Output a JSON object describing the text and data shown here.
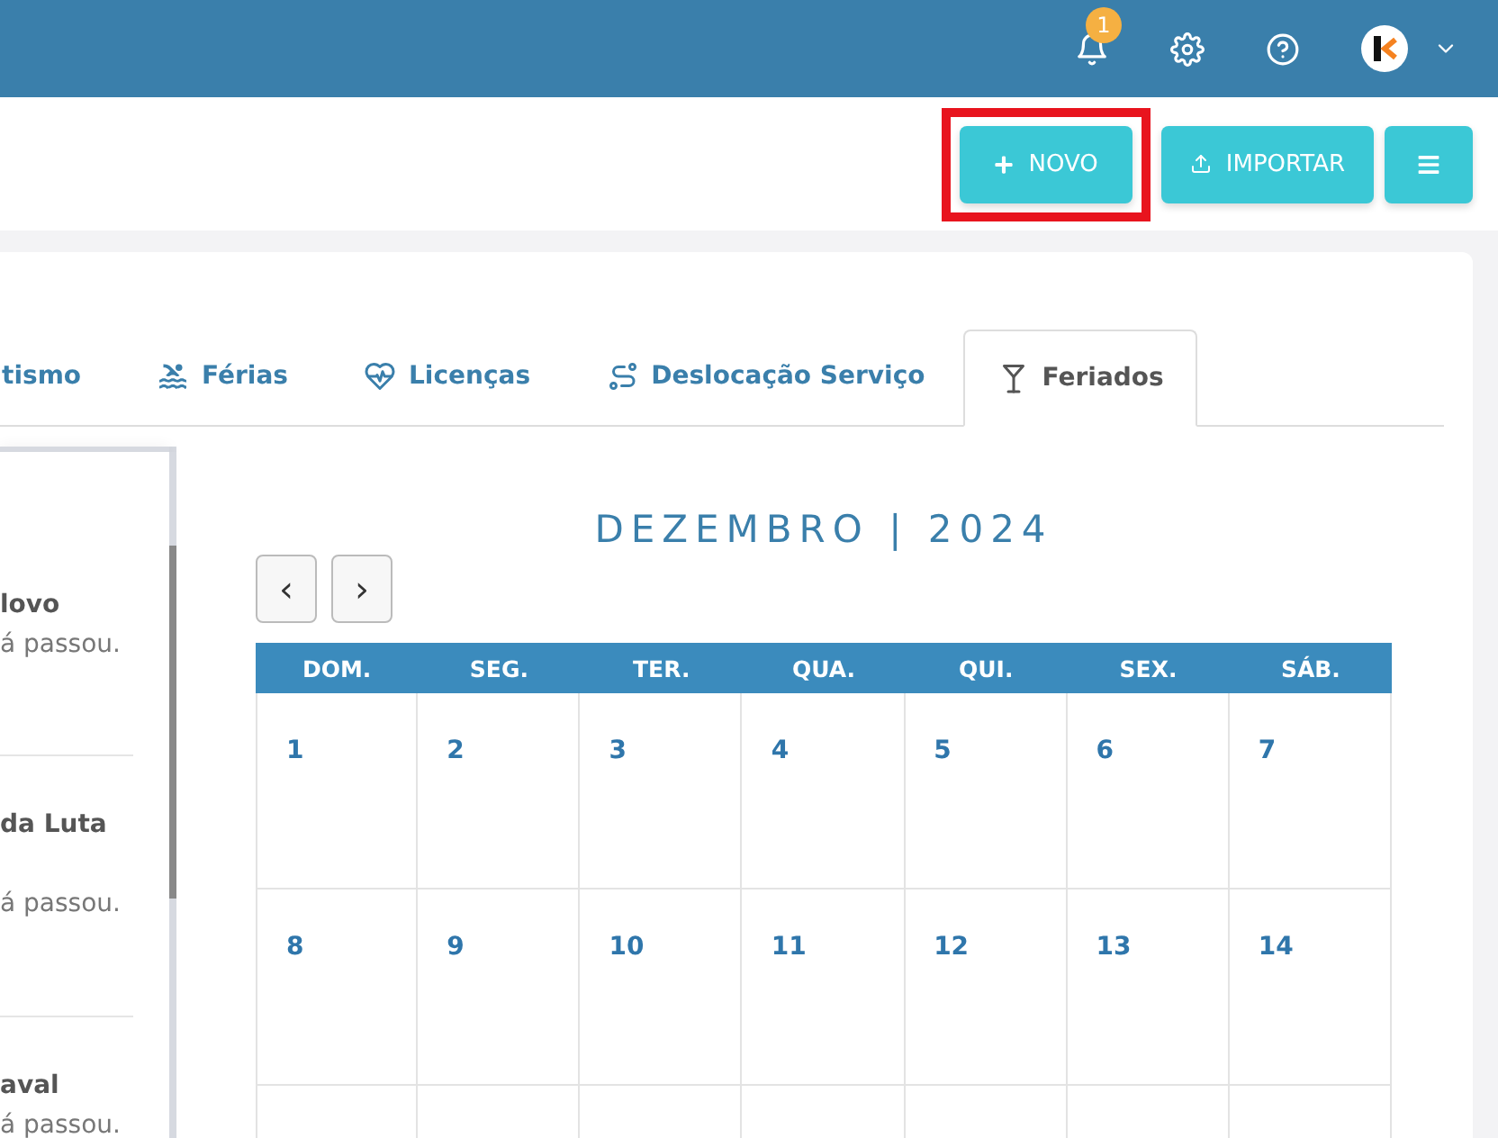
{
  "topbar": {
    "notification_count": "1"
  },
  "actions": {
    "primary": "NOVO",
    "import": "IMPORTAR"
  },
  "tabs": [
    {
      "label": "tismo",
      "selected": false
    },
    {
      "label": "Férias",
      "selected": false
    },
    {
      "label": "Licenças",
      "selected": false
    },
    {
      "label": "Deslocação Serviço",
      "selected": false
    },
    {
      "label": "Feriados",
      "selected": true
    }
  ],
  "holidays": [
    {
      "title": "lovo",
      "status": "á passou."
    },
    {
      "title": "da Luta",
      "status": "á passou."
    },
    {
      "title": "aval",
      "status": "á passou."
    }
  ],
  "calendar": {
    "title": "DEZEMBRO | 2024",
    "prev": "‹",
    "next": "›",
    "weekdays": [
      "DOM.",
      "SEG.",
      "TER.",
      "QUA.",
      "QUI.",
      "SEX.",
      "SÁB."
    ],
    "weeks": [
      [
        "1",
        "2",
        "3",
        "4",
        "5",
        "6",
        "7"
      ],
      [
        "8",
        "9",
        "10",
        "11",
        "12",
        "13",
        "14"
      ]
    ]
  }
}
